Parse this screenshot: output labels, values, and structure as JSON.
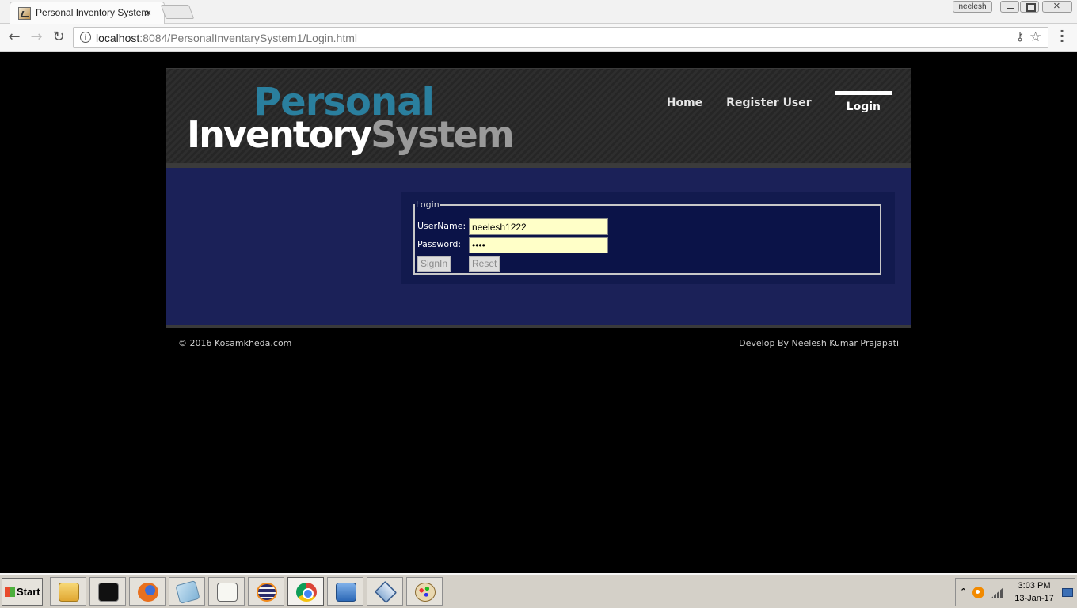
{
  "browser": {
    "tab_title": "Personal Inventory System",
    "tab_close": "×",
    "user": "neelesh",
    "url_host": "localhost",
    "url_path": ":8084/PersonalInventarySystem1/Login.html",
    "icons": [
      "back-icon",
      "forward-icon",
      "reload-icon",
      "info-icon",
      "key-icon",
      "star-icon",
      "menu-icon"
    ]
  },
  "site": {
    "logo_top": "Personal",
    "logo_word1": "Inventory",
    "logo_word2": "System",
    "nav": [
      {
        "label": "Home"
      },
      {
        "label": "Register User"
      },
      {
        "label": "Login",
        "active": true
      }
    ],
    "accent_color": "#2a7f9e",
    "content_bg": "#1b2158"
  },
  "login": {
    "legend": "Login",
    "username_label": "UserName:",
    "username_value": "neelesh1222",
    "password_label": "Password:",
    "password_value": "••••",
    "signin_label": "SignIn",
    "reset_label": "Reset"
  },
  "footer": {
    "copyright": "© 2016 Kosamkheda.com",
    "credit": "Develop By Neelesh Kumar Prajapati"
  },
  "taskbar": {
    "start_label": "Start",
    "apps": [
      "explorer-icon",
      "cmd-icon",
      "firefox-icon",
      "notepad-icon",
      "editor-icon",
      "eclipse-icon",
      "chrome-icon",
      "flash-icon",
      "virtualbox-icon",
      "paint-icon"
    ],
    "time": "3:03 PM",
    "date": "13-Jan-17"
  }
}
